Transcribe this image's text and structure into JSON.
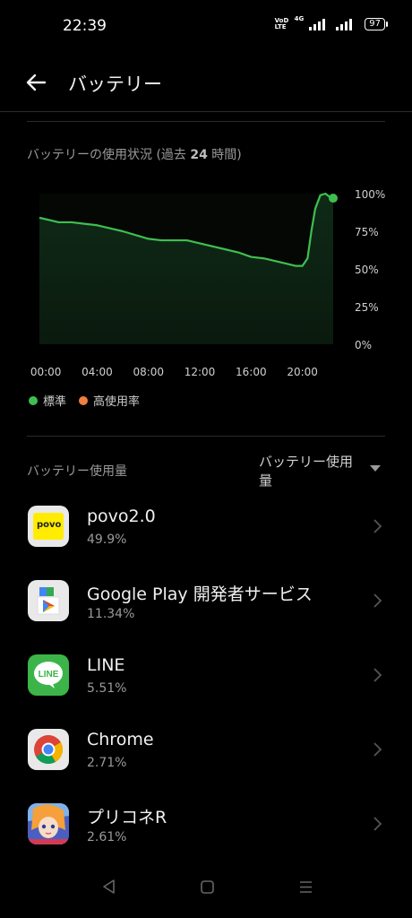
{
  "status_bar": {
    "time": "22:39",
    "volte_line1": "VoD",
    "volte_line2": "LTE",
    "network": "4G",
    "battery": "97"
  },
  "app_bar": {
    "title": "バッテリー",
    "back_icon": "arrow-left-icon"
  },
  "usage_history": {
    "label_prefix": "バッテリーの使用状況 (過去 ",
    "label_hours": "24",
    "label_suffix": " 時間)"
  },
  "chart_data": {
    "type": "area",
    "x_labels": [
      "00:00",
      "04:00",
      "08:00",
      "12:00",
      "16:00",
      "20:00"
    ],
    "y_labels": [
      "100%",
      "75%",
      "50%",
      "25%",
      "0%"
    ],
    "ylim": [
      0,
      100
    ],
    "xlim_hours": [
      -0.5,
      22.4
    ],
    "grid": false,
    "series": [
      {
        "name": "標準",
        "color": "#3fbf4f",
        "points": [
          [
            -0.5,
            84
          ],
          [
            0.5,
            82
          ],
          [
            1.0,
            81
          ],
          [
            2.0,
            81
          ],
          [
            3.0,
            80
          ],
          [
            4.0,
            79
          ],
          [
            6.0,
            75
          ],
          [
            8.0,
            70
          ],
          [
            9.0,
            69
          ],
          [
            11.0,
            69
          ],
          [
            13.0,
            65
          ],
          [
            15.0,
            61
          ],
          [
            16.0,
            58
          ],
          [
            17.0,
            57
          ],
          [
            18.0,
            55
          ],
          [
            19.0,
            53
          ],
          [
            19.5,
            52
          ],
          [
            20.0,
            52
          ],
          [
            20.4,
            57
          ],
          [
            20.7,
            75
          ],
          [
            21.0,
            90
          ],
          [
            21.4,
            99
          ],
          [
            21.8,
            100
          ],
          [
            22.1,
            98
          ],
          [
            22.4,
            97
          ]
        ]
      }
    ],
    "legend": [
      {
        "label": "標準",
        "color": "#3fbf4f"
      },
      {
        "label": "高使用率",
        "color": "#f07f3f"
      }
    ]
  },
  "usage": {
    "title": "バッテリー使用量",
    "sort_label": "バッテリー使用量",
    "apps": [
      {
        "name": "povo2.0",
        "percent": "49.9%",
        "icon": "povo-icon"
      },
      {
        "name": "Google Play 開発者サービス",
        "percent": "11.34%",
        "icon": "google-play-services-icon"
      },
      {
        "name": "LINE",
        "percent": "5.51%",
        "icon": "line-icon"
      },
      {
        "name": "Chrome",
        "percent": "2.71%",
        "icon": "chrome-icon"
      },
      {
        "name": "プリコネR",
        "percent": "2.61%",
        "icon": "priconne-icon"
      }
    ]
  },
  "icons": {
    "povo_text": "povo",
    "line_text": "LINE"
  },
  "nav": {
    "back_icon": "nav-back-icon",
    "home_icon": "nav-home-icon",
    "recents_icon": "nav-menu-icon"
  }
}
